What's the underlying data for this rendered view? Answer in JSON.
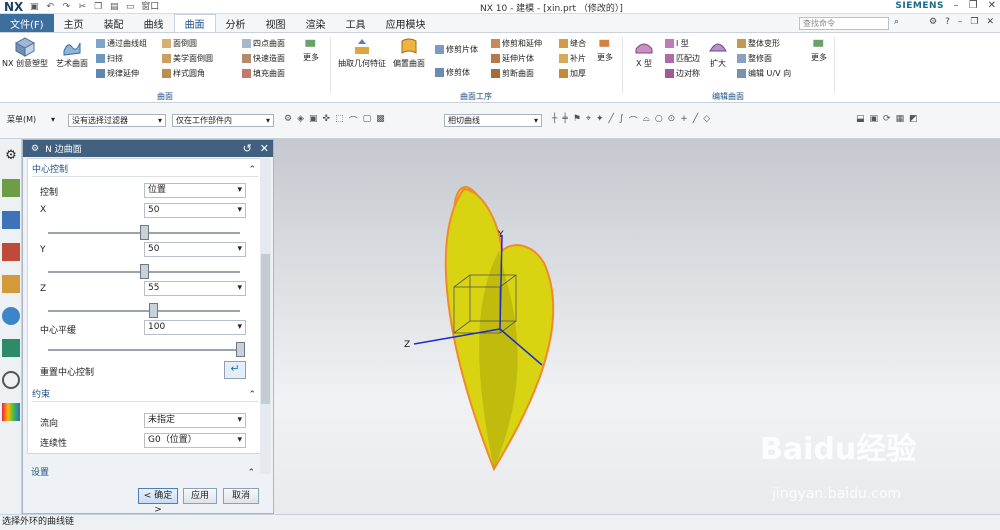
{
  "app": {
    "logo": "NX",
    "window_title": "NX 10 - 建模 - [xin.prt （修改的）]",
    "brand": "SIEMENS",
    "window_menu": "窗口"
  },
  "menu": {
    "file": "文件(F)",
    "tabs": [
      "主页",
      "装配",
      "曲线",
      "曲面",
      "分析",
      "视图",
      "渲染",
      "工具",
      "应用模块"
    ],
    "active_tab": "曲面",
    "search_placeholder": "查找命令"
  },
  "ribbon": {
    "group1": {
      "label": "曲面",
      "big": [
        "NX 创意塑型",
        "艺术曲面"
      ],
      "small_col1": [
        "通过曲线组",
        "扫掠",
        "规律延伸"
      ],
      "small_col2": [
        "面倒圆",
        "美学面倒圆",
        "样式圆角"
      ],
      "small_col3": [
        "四点曲面",
        "快速造面",
        "填充曲面"
      ],
      "more": "更多"
    },
    "group2": {
      "label": "曲面工序",
      "big": [
        "抽取几何特征",
        "偏置曲面"
      ],
      "small_col1": [
        "修剪片体",
        "修剪体"
      ],
      "small_col2": [
        "修剪和延伸",
        "延伸片体",
        "剪断曲面"
      ],
      "small_col3": [
        "缝合",
        "补片",
        "加厚"
      ],
      "more": "更多"
    },
    "group3": {
      "label": "编辑曲面",
      "big": [
        "X 型"
      ],
      "small_col1": [
        "I 型",
        "匹配边",
        "边对称"
      ],
      "big2": "扩大",
      "small_col2": [
        "整体变形",
        "整修面",
        "编辑 U/V 向"
      ],
      "more": "更多"
    }
  },
  "toolbar": {
    "menu_label": "菜单(M)",
    "filter": "没有选择过滤器",
    "scope": "仅在工作部件内",
    "curve_rule": "相切曲线"
  },
  "dialog": {
    "title": "N 边曲面",
    "section_center": "中心控制",
    "control_label": "控制",
    "control_value": "位置",
    "x_label": "X",
    "x_value": "50",
    "x_level": 0.5,
    "y_label": "Y",
    "y_value": "50",
    "y_level": 0.5,
    "z_label": "Z",
    "z_value": "55",
    "z_level": 0.55,
    "flat_label": "中心平缓",
    "flat_value": "100",
    "flat_level": 1.0,
    "reset_label": "重置中心控制",
    "section_constraint": "约束",
    "flow_label": "流向",
    "flow_value": "未指定",
    "continuity_label": "连续性",
    "continuity_value": "G0（位置）",
    "section_settings": "设置",
    "ok": "< 确定 >",
    "apply": "应用",
    "cancel": "取消"
  },
  "viewport": {
    "axis_y": "Y",
    "axis_z": "Z",
    "surface_color": "#d8d411",
    "edge_color": "#f08a2a"
  },
  "status": {
    "text": "选择外环的曲线链"
  },
  "watermark": {
    "main": "Baidu经验",
    "sub": "jingyan.baidu.com"
  }
}
